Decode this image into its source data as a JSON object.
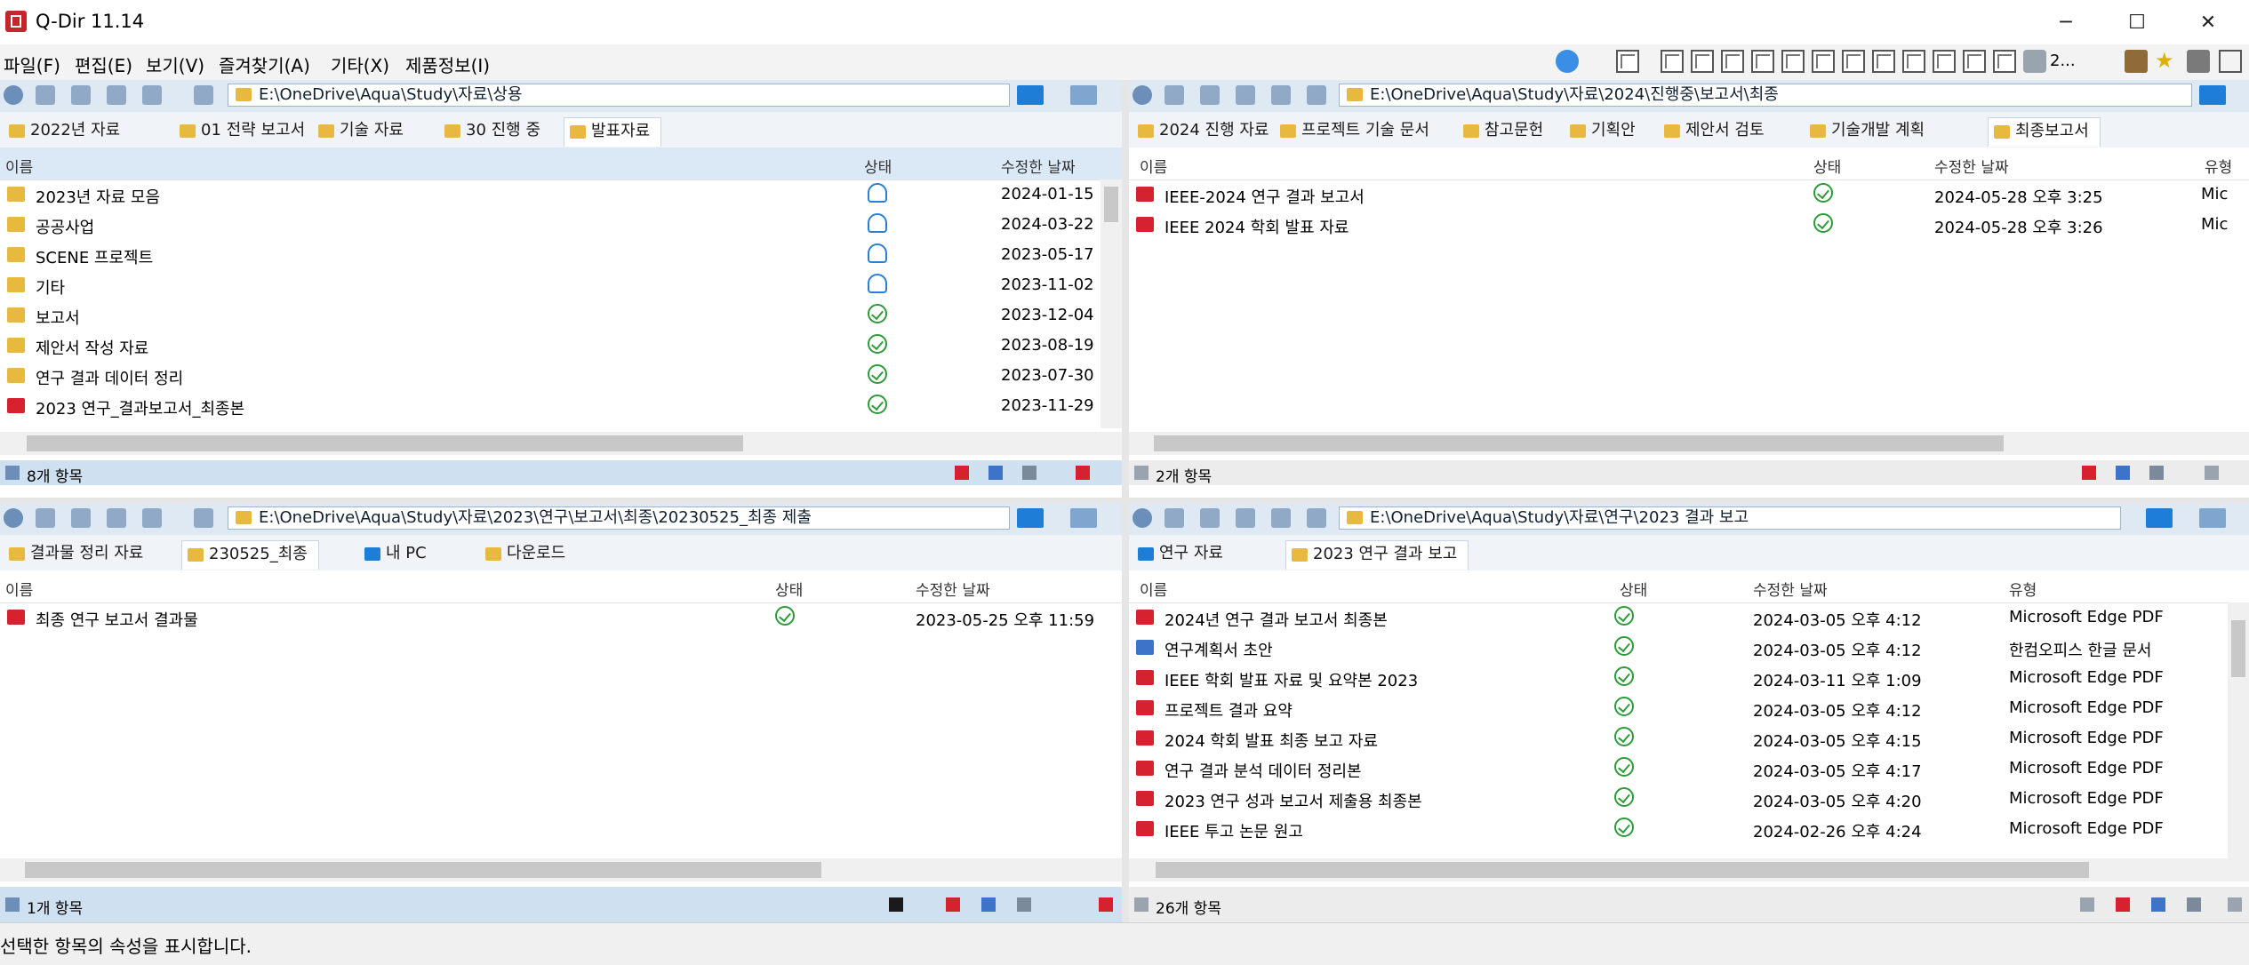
{
  "window": {
    "title": "Q-Dir 11.14",
    "controls": [
      "─",
      "☐",
      "✕"
    ]
  },
  "menu": [
    "파일(F)",
    "편집(E)",
    "보기(V)",
    "즐겨찾기(A)",
    "기타(X)",
    "제품정보(I)"
  ],
  "toolbar": {
    "count_label": "2..."
  },
  "panes": {
    "top_left": {
      "address": "E:\\OneDrive\\Aqua\\Study\\자료\\상용",
      "tabs": [
        "2022년 자료",
        "01 전략 보고서",
        "기술 자료",
        "30 진행 중",
        "발표자료"
      ],
      "active_tab": 4,
      "columns": [
        "이름",
        "상태",
        "수정한 날짜"
      ],
      "rows": [
        {
          "name": "2023년 자료 모음",
          "type": "folder",
          "status": "cloud",
          "date": "2024-01-15"
        },
        {
          "name": "공공사업",
          "type": "folder",
          "status": "cloud",
          "date": "2024-03-22"
        },
        {
          "name": "SCENE 프로젝트",
          "type": "folder",
          "status": "cloud",
          "date": "2023-05-17"
        },
        {
          "name": "기타",
          "type": "folder",
          "status": "cloud",
          "date": "2023-11-02"
        },
        {
          "name": "보고서",
          "type": "folder",
          "status": "ok",
          "date": "2023-12-04"
        },
        {
          "name": "제안서 작성 자료",
          "type": "folder",
          "status": "ok",
          "date": "2023-08-19"
        },
        {
          "name": "연구 결과 데이터 정리",
          "type": "folder",
          "status": "ok",
          "date": "2023-07-30"
        },
        {
          "name": "2023 연구_결과보고서_최종본",
          "type": "pdf",
          "status": "ok",
          "date": "2023-11-29"
        }
      ],
      "status_label": "8개 항목"
    },
    "top_right": {
      "address": "E:\\OneDrive\\Aqua\\Study\\자료\\2024\\진행중\\보고서\\최종",
      "tabs": [
        "2024 진행 자료",
        "프로젝트 기술 문서",
        "참고문헌",
        "기획안",
        "제안서 검토",
        "기술개발 계획",
        "최종보고서"
      ],
      "active_tab": 6,
      "columns": [
        "이름",
        "상태",
        "수정한 날짜",
        "유형"
      ],
      "rows": [
        {
          "name": "IEEE-2024 연구 결과 보고서",
          "type": "pdf",
          "status": "ok",
          "date": "2024-05-28 오후 3:25",
          "kind": "Mic"
        },
        {
          "name": "IEEE 2024 학회 발표 자료",
          "type": "pdf",
          "status": "ok",
          "date": "2024-05-28 오후 3:26",
          "kind": "Mic"
        }
      ],
      "status_label": "2개 항목"
    },
    "bottom_left": {
      "address": "E:\\OneDrive\\Aqua\\Study\\자료\\2023\\연구\\보고서\\최종\\20230525_최종 제출",
      "tabs": [
        "결과물 정리 자료",
        "230525_최종",
        "내 PC",
        "다운로드"
      ],
      "active_tab": 1,
      "columns": [
        "이름",
        "상태",
        "수정한 날짜"
      ],
      "rows": [
        {
          "name": "최종 연구 보고서 결과물",
          "type": "pdf",
          "status": "ok",
          "date": "2023-05-25 오후 11:59"
        }
      ],
      "status_label": "1개 항목"
    },
    "bottom_right": {
      "address": "E:\\OneDrive\\Aqua\\Study\\자료\\연구\\2023 결과 보고",
      "tabs": [
        "연구 자료",
        "2023 연구 결과 보고"
      ],
      "active_tab": 1,
      "columns": [
        "이름",
        "상태",
        "수정한 날짜",
        "유형"
      ],
      "rows": [
        {
          "name": "2024년 연구 결과 보고서 최종본",
          "type": "pdf",
          "status": "ok",
          "date": "2024-03-05 오후 4:12",
          "kind": "Microsoft Edge PDF"
        },
        {
          "name": "연구계획서 초안",
          "type": "doc",
          "status": "ok",
          "date": "2024-03-05 오후 4:12",
          "kind": "한컴오피스 한글 문서"
        },
        {
          "name": "IEEE 학회 발표 자료 및 요약본 2023",
          "type": "pdf",
          "status": "ok",
          "date": "2024-03-11 오후 1:09",
          "kind": "Microsoft Edge PDF"
        },
        {
          "name": "프로젝트 결과 요약",
          "type": "pdf",
          "status": "ok",
          "date": "2024-03-05 오후 4:12",
          "kind": "Microsoft Edge PDF"
        },
        {
          "name": "2024 학회 발표 최종 보고 자료",
          "type": "pdf",
          "status": "ok",
          "date": "2024-03-05 오후 4:15",
          "kind": "Microsoft Edge PDF"
        },
        {
          "name": "연구 결과 분석 데이터 정리본",
          "type": "pdf",
          "status": "ok",
          "date": "2024-03-05 오후 4:17",
          "kind": "Microsoft Edge PDF"
        },
        {
          "name": "2023 연구 성과 보고서 제출용 최종본",
          "type": "pdf",
          "status": "ok",
          "date": "2024-03-05 오후 4:20",
          "kind": "Microsoft Edge PDF"
        },
        {
          "name": "IEEE 투고 논문 원고",
          "type": "pdf",
          "status": "ok",
          "date": "2024-02-26 오후 4:24",
          "kind": "Microsoft Edge PDF"
        }
      ],
      "status_label": "26개 항목"
    }
  },
  "footer": {
    "text": "선택한 항목의 속성을 표시합니다."
  },
  "colors": {
    "accent": "#1e7dd6",
    "folder": "#e8b93f",
    "pdf": "#d6212e",
    "status_ok": "#2f9a3a",
    "status_cloud": "#2b7fd4",
    "pane_header": "#dfe9f4"
  }
}
